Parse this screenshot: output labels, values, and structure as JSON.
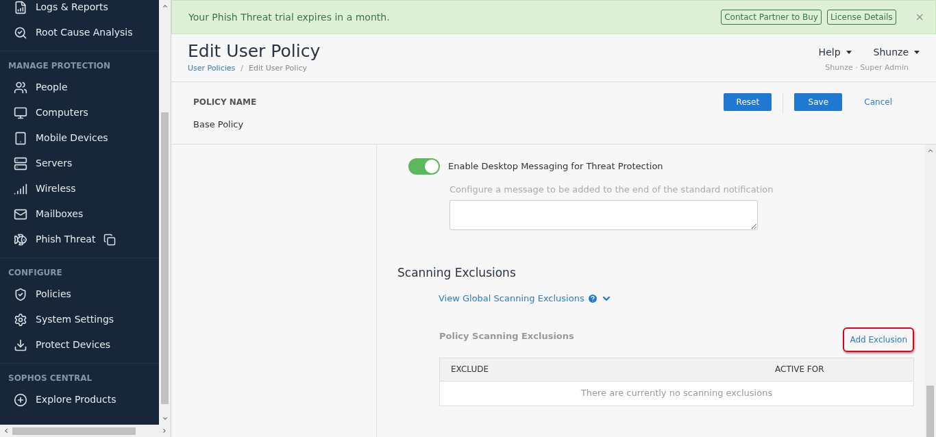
{
  "sidebar": {
    "sections": [
      {
        "items": [
          {
            "label": "Logs & Reports"
          },
          {
            "label": "Root Cause Analysis"
          }
        ]
      },
      {
        "heading": "MANAGE PROTECTION",
        "items": [
          {
            "label": "People"
          },
          {
            "label": "Computers"
          },
          {
            "label": "Mobile Devices"
          },
          {
            "label": "Servers"
          },
          {
            "label": "Wireless"
          },
          {
            "label": "Mailboxes"
          },
          {
            "label": "Phish Threat",
            "external": true
          }
        ]
      },
      {
        "heading": "CONFIGURE",
        "items": [
          {
            "label": "Policies"
          },
          {
            "label": "System Settings"
          },
          {
            "label": "Protect Devices"
          }
        ]
      },
      {
        "heading": "SOPHOS CENTRAL",
        "items": [
          {
            "label": "Explore Products"
          }
        ]
      }
    ]
  },
  "banner": {
    "message": "Your Phish Threat trial expires in a month.",
    "buttons": [
      "Contact Partner to Buy",
      "License Details"
    ],
    "close": "×"
  },
  "header": {
    "title": "Edit User Policy",
    "breadcrumb": [
      "User Policies",
      "Edit User Policy"
    ],
    "breadcrumb_separator": "/",
    "menus": [
      "Help",
      "Shunze"
    ],
    "user_role": "Shunze · Super Admin"
  },
  "policy": {
    "label": "POLICY NAME",
    "value": "Base Policy",
    "buttons": [
      "Reset",
      "Save"
    ],
    "cancel": "Cancel"
  },
  "content": {
    "toggle": {
      "label": "Enable Desktop Messaging for Threat Protection",
      "on": true
    },
    "message_field": {
      "label": "Configure a message to be added to the end of the standard notification"
    },
    "section_title": "Scanning Exclusions",
    "global_link": "View Global Scanning Exclusions",
    "policy_exclusions_title": "Policy Scanning Exclusions",
    "add_exclusion": {
      "label": "Add Exclusion",
      "highlighted": true
    },
    "table": {
      "columns": [
        "EXCLUDE",
        "ACTIVE FOR"
      ],
      "empty_message": "There are currently no scanning exclusions"
    }
  }
}
